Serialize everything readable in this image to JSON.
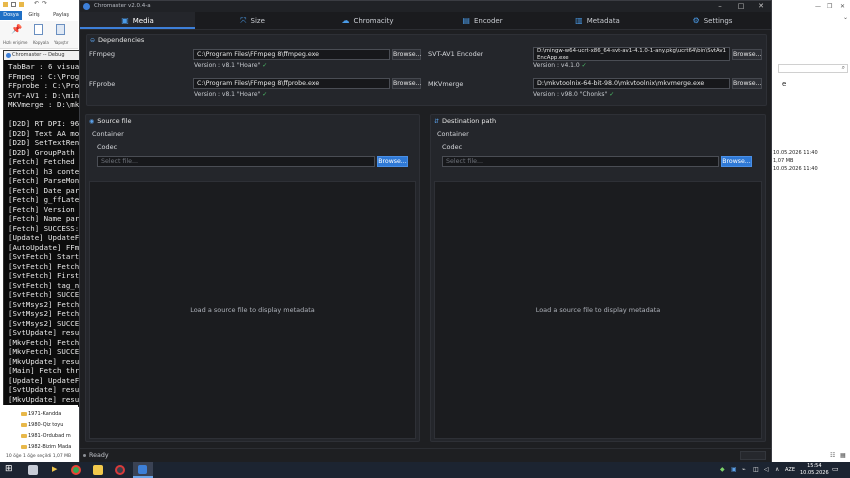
{
  "explorer": {
    "tabs": [
      "Dosya",
      "Giriş",
      "Paylaş"
    ],
    "ribbon_labels": [
      "Hızlı erişime",
      "Kopyala",
      "Yapıştır"
    ],
    "debug_title": "Chromaster -- Debug",
    "debug_lines": [
      "TabBar : 6 visual tabs",
      "FFmpeg : C:\\Program",
      "FFprobe : C:\\Program",
      "SVT-AV1 : D:\\mingw-w",
      "MKVmerge : D:\\mkvto",
      "",
      "[D2D] RT DPI: 96 x 96 (",
      "[D2D] Text AA mode: 2",
      "[D2D] SetTextRendering",
      "[D2D] GroupPath OK: ba",
      "[Fetch] Fetched 92228",
      "[Fetch] h3 content: \"Ma",
      "[Fetch] ParseMonthNa",
      "[Fetch] Date parsed: m",
      "[Fetch] g_ffLatestDate",
      "[Fetch] Version parsed:",
      "[Fetch] Name parsed: \"",
      "[Fetch] SUCCESS: FFmp",
      "[Update] UpdateFFVers",
      "[AutoUpdate] FFmpeg c",
      "[SvtFetch] Starting GitL",
      "[SvtFetch] Fetched 458",
      "[SvtFetch] First 100 cha",
      "[SvtFetch] tag_name =",
      "[SvtFetch] SUCCESS: S",
      "[SvtMsys2] Fetching M",
      "[SvtMsys2] Fetched 16",
      "[SvtMsys2] SUCCESS: v",
      "[SvtUpdate] result: 4.1.",
      "[MkvFetch] Fetched 51",
      "[MkvFetch] SUCCESS: M",
      "[MkvUpdate] result: 98.",
      "[Main] Fetch thread do",
      "[Update] UpdateFFVers",
      "[SvtUpdate] result: 4.1.",
      "[MkvUpdate] result: 98."
    ],
    "files": [
      "1971-Kandda",
      "1980-Qiz toyu",
      "1981-Ordubad m",
      "1982-Bizim Mada"
    ],
    "status": "10 öğe    1 öğe seçildi  1,07 MB"
  },
  "right_explorer": {
    "letter": "e",
    "meta": [
      "10.05.2026 11:40",
      "1,07 MB",
      "10.05.2026 11:40"
    ]
  },
  "app": {
    "title": "Chromaster v2.0.4-a",
    "tabs": [
      {
        "label": "Media",
        "icon": "media-icon",
        "glyph": "▣"
      },
      {
        "label": "Size",
        "icon": "size-icon",
        "glyph": "⤧"
      },
      {
        "label": "Chromacity",
        "icon": "chromacity-icon",
        "glyph": "☁"
      },
      {
        "label": "Encoder",
        "icon": "encoder-icon",
        "glyph": "▤"
      },
      {
        "label": "Metadata",
        "icon": "metadata-icon",
        "glyph": "▥"
      },
      {
        "label": "Settings",
        "icon": "settings-icon",
        "glyph": "⚙"
      }
    ],
    "dependencies": {
      "title": "Dependencies",
      "browse_label": "Browse...",
      "items": [
        {
          "name": "FFmpeg",
          "path": "C:\\Program Files\\FFmpeg 8\\ffmpeg.exe",
          "version": "Version : v8.1 \"Hoare\""
        },
        {
          "name": "FFprobe",
          "path": "C:\\Program Files\\FFmpeg 8\\ffprobe.exe",
          "version": "Version : v8.1 \"Hoare\""
        },
        {
          "name": "SVT-AV1 Encoder",
          "path": "D:\\mingw-w64-ucrt-x86_64-svt-av1-4.1.0-1-any.pkg\\ucrt64\\bin\\SvtAv1EncApp.exe",
          "version": "Version : v4.1.0"
        },
        {
          "name": "MKVmerge",
          "path": "D:\\mkvtoolnix-64-bit-98.0\\mkvtoolnix\\mkvmerge.exe",
          "version": "Version : v98.0 \"Chonks\""
        }
      ],
      "check": "✓"
    },
    "source": {
      "title": "Source file",
      "container_label": "Container",
      "codec_label": "Codec",
      "placeholder": "Select file...",
      "browse_label": "Browse...",
      "metadata_msg": "Load a source file to display metadata"
    },
    "destination": {
      "title": "Destination path",
      "container_label": "Container",
      "codec_label": "Codec",
      "placeholder": "Select file...",
      "browse_label": "Browse...",
      "metadata_msg": "Load a source file to display metadata"
    },
    "status": "Ready"
  },
  "taskbar": {
    "lang": "AZE",
    "time": "15:54",
    "date": "10.05.2026"
  },
  "colors": {
    "accent": "#3d7fd8",
    "ok": "#4ec46a",
    "app_bg": "#1e1f22",
    "panel_bg": "#24262b"
  }
}
